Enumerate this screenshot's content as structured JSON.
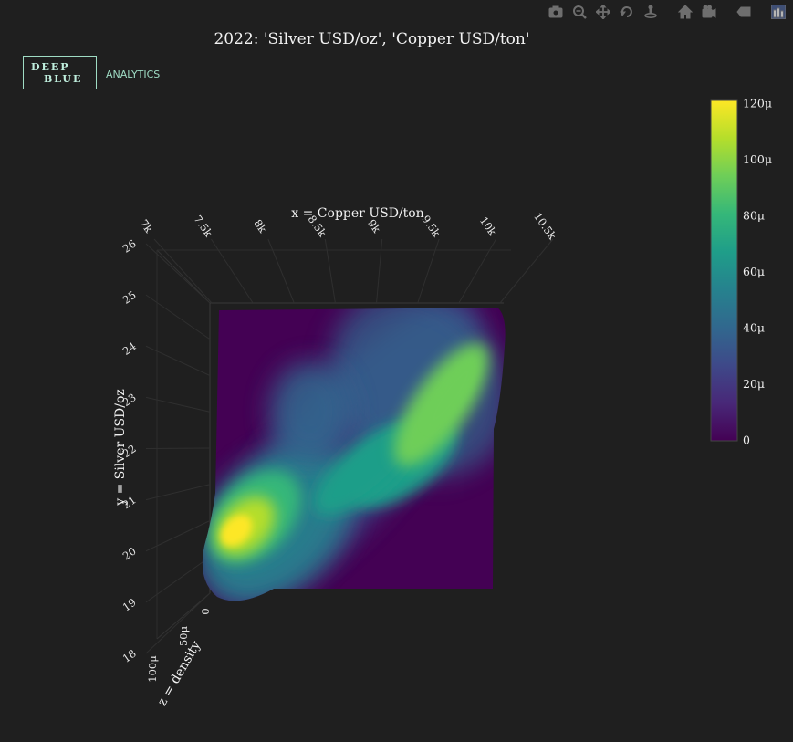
{
  "modebar": {
    "buttons": [
      {
        "name": "camera-icon",
        "title": "Download plot as a png"
      },
      {
        "name": "zoom-icon",
        "title": "Zoom"
      },
      {
        "name": "pan-icon",
        "title": "Pan"
      },
      {
        "name": "orbit-rotation-icon",
        "title": "Orbital rotation"
      },
      {
        "name": "turntable-icon",
        "title": "Turntable rotation"
      },
      {
        "name": "home-icon",
        "title": "Reset camera to default"
      },
      {
        "name": "camera-last-save-icon",
        "title": "Reset camera to last save"
      },
      {
        "name": "hover-toggle-icon",
        "title": "Toggle show closest data on hover"
      },
      {
        "name": "plotly-logo-icon",
        "title": "Produced with Plotly"
      }
    ],
    "icon_color": "#6e6e6e"
  },
  "logo": {
    "line1": "DEEP",
    "line2": "BLUE",
    "tagline": "ANALYTICS",
    "color": "#9fdcc4"
  },
  "chart_data": {
    "type": "surface",
    "title": "2022: 'Silver USD/oz', 'Copper USD/ton'",
    "xlabel": "x = Copper USD/ton",
    "ylabel": "y = Silver USD/oz",
    "zlabel": "z = density",
    "x_ticks": [
      "7k",
      "7.5k",
      "8k",
      "8.5k",
      "9k",
      "9.5k",
      "10k",
      "10.5k"
    ],
    "y_ticks": [
      "18",
      "19",
      "20",
      "21",
      "22",
      "23",
      "24",
      "25",
      "26"
    ],
    "z_ticks": [
      "0",
      "50μ",
      "100μ"
    ],
    "xlim": [
      7000,
      10500
    ],
    "ylim": [
      18,
      26
    ],
    "colorscale": "viridis",
    "colorscale_stops": [
      "#440154",
      "#482878",
      "#3e4989",
      "#31688e",
      "#26828e",
      "#1f9e89",
      "#35b779",
      "#6ece58",
      "#b5de2b",
      "#fde725"
    ],
    "colorbar": {
      "ticks": [
        "120μ",
        "100μ",
        "80μ",
        "60μ",
        "40μ",
        "20μ",
        "0"
      ],
      "range": [
        0,
        0.00012
      ]
    },
    "density_peaks": [
      {
        "x": 7300,
        "y": 19.6,
        "density": 0.00012
      },
      {
        "x": 9900,
        "y": 23.7,
        "density": 9e-05
      },
      {
        "x": 9300,
        "y": 22.1,
        "density": 7e-05
      },
      {
        "x": 8200,
        "y": 23.0,
        "density": 4e-05
      }
    ]
  }
}
